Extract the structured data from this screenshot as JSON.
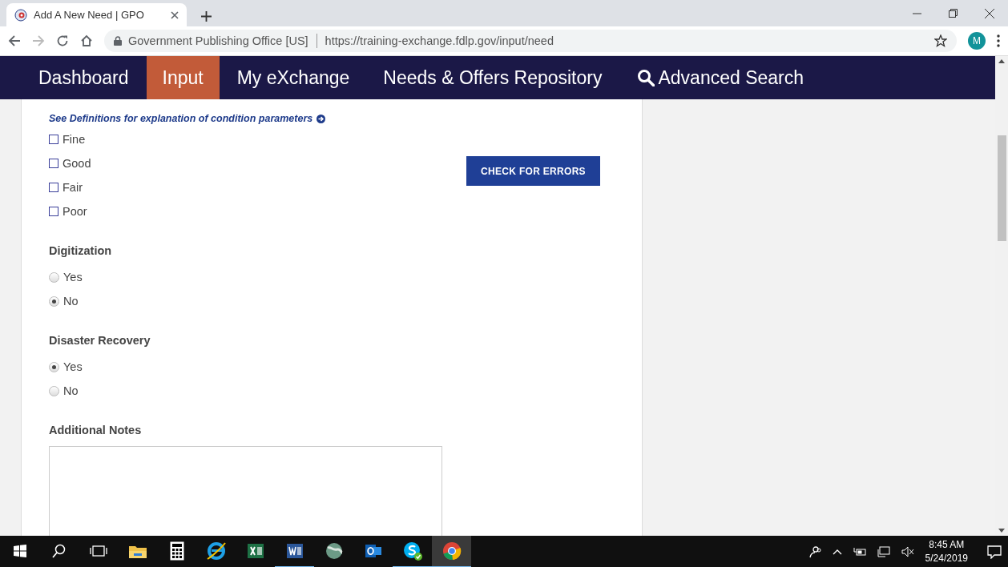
{
  "browser": {
    "tab_title": "Add A New Need | GPO",
    "site_name": "Government Publishing Office [US]",
    "url": "https://training-exchange.fdlp.gov/input/need",
    "profile_initial": "M"
  },
  "nav": [
    {
      "label": "Dashboard",
      "selected": false,
      "kind": "link"
    },
    {
      "label": "Input",
      "selected": true,
      "kind": "link"
    },
    {
      "label": "My eXchange",
      "selected": false,
      "kind": "link"
    },
    {
      "label": "Needs & Offers Repository",
      "selected": false,
      "kind": "link"
    },
    {
      "label": "Advanced Search",
      "selected": false,
      "kind": "search"
    }
  ],
  "definitions_link": "See Definitions for explanation of condition parameters",
  "conditions": [
    {
      "label": "Fine",
      "checked": false
    },
    {
      "label": "Good",
      "checked": false
    },
    {
      "label": "Fair",
      "checked": false
    },
    {
      "label": "Poor",
      "checked": false
    }
  ],
  "check_button": "CHECK FOR ERRORS",
  "groups": [
    {
      "heading": "Digitization",
      "options": [
        {
          "label": "Yes",
          "selected": false
        },
        {
          "label": "No",
          "selected": true
        }
      ]
    },
    {
      "heading": "Disaster Recovery",
      "options": [
        {
          "label": "Yes",
          "selected": true
        },
        {
          "label": "No",
          "selected": false
        }
      ]
    }
  ],
  "additional_notes": {
    "heading": "Additional Notes"
  },
  "taskbar": {
    "time": "8:45 AM",
    "date": "5/24/2019",
    "apps": [
      {
        "kind": "explorer",
        "running": false,
        "selected": false
      },
      {
        "kind": "calculator",
        "running": false,
        "selected": false
      },
      {
        "kind": "ie",
        "running": false,
        "selected": false
      },
      {
        "kind": "excel",
        "running": false,
        "selected": false
      },
      {
        "kind": "word",
        "running": true,
        "selected": false
      },
      {
        "kind": "globe",
        "running": false,
        "selected": false
      },
      {
        "kind": "outlook",
        "running": false,
        "selected": false
      },
      {
        "kind": "skype",
        "running": true,
        "selected": false
      },
      {
        "kind": "chrome",
        "running": true,
        "selected": true
      }
    ]
  }
}
